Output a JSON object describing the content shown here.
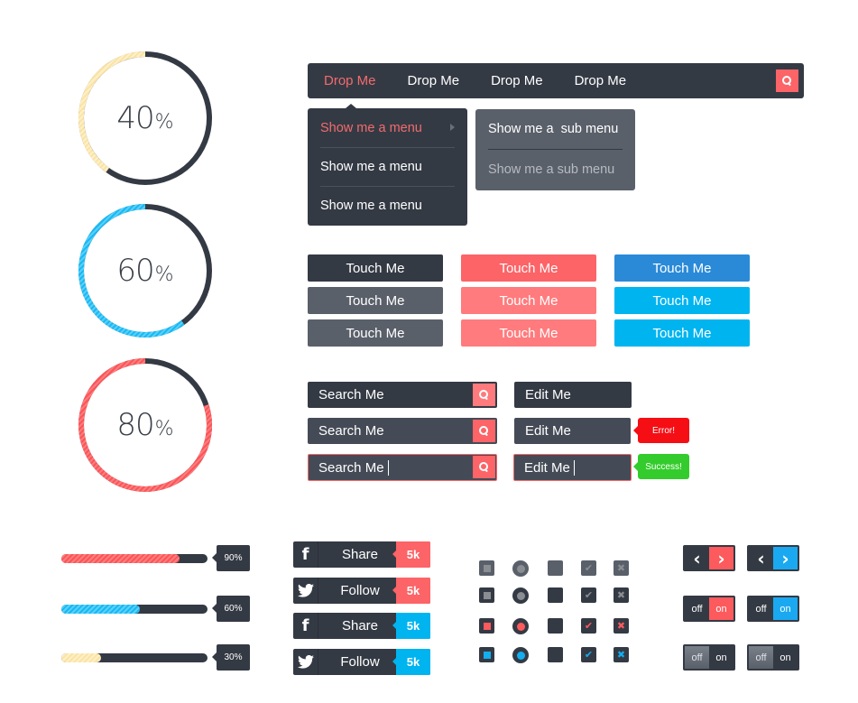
{
  "colors": {
    "dark": "#343a44",
    "gray": "#5a606a",
    "red": "#fc6467",
    "red_light": "#ff7a7c",
    "blue": "#2a8ad8",
    "cyan": "#00b4f0",
    "yellow": "#fbe3a2",
    "error": "#f50e14",
    "success": "#34cc2c"
  },
  "rings": [
    {
      "value": 40,
      "number_label": "40",
      "percent_sign": "%",
      "color": "yellow"
    },
    {
      "value": 60,
      "number_label": "60",
      "percent_sign": "%",
      "color": "cyan"
    },
    {
      "value": 80,
      "number_label": "80",
      "percent_sign": "%",
      "color": "red"
    }
  ],
  "navbar": {
    "items": [
      {
        "label": "Drop Me",
        "active": true
      },
      {
        "label": "Drop Me",
        "active": false
      },
      {
        "label": "Drop Me",
        "active": false
      },
      {
        "label": "Drop Me",
        "active": false
      }
    ],
    "search_icon": "search-icon"
  },
  "dropdown": {
    "items": [
      {
        "label": "Show me a menu",
        "active": true,
        "has_submenu": true
      },
      {
        "label": "Show me a menu",
        "active": false
      },
      {
        "label": "Show me a menu",
        "active": false
      }
    ]
  },
  "submenu": {
    "items": [
      {
        "label": "Show me a  sub menu"
      },
      {
        "label": "Show me a sub menu"
      }
    ]
  },
  "buttons": [
    {
      "label": "Touch Me",
      "style": "dark",
      "state": "normal"
    },
    {
      "label": "Touch Me",
      "style": "red",
      "state": "normal"
    },
    {
      "label": "Touch Me",
      "style": "blue",
      "state": "normal"
    },
    {
      "label": "Touch Me",
      "style": "dark",
      "state": "hover"
    },
    {
      "label": "Touch Me",
      "style": "red",
      "state": "hover"
    },
    {
      "label": "Touch Me",
      "style": "blue",
      "state": "hover"
    },
    {
      "label": "Touch Me",
      "style": "dark",
      "state": "active"
    },
    {
      "label": "Touch Me",
      "style": "red",
      "state": "active"
    },
    {
      "label": "Touch Me",
      "style": "blue",
      "state": "active"
    }
  ],
  "search_inputs": [
    {
      "value": "Search Me",
      "state": "normal"
    },
    {
      "value": "Search Me",
      "state": "hover"
    },
    {
      "value": "Search Me",
      "state": "focus"
    }
  ],
  "edit_inputs": [
    {
      "value": "Edit Me",
      "state": "normal"
    },
    {
      "value": "Edit Me",
      "state": "hover",
      "tooltip": "Error!"
    },
    {
      "value": "Edit Me",
      "state": "focus",
      "tooltip": "Success!"
    }
  ],
  "progress_bars": [
    {
      "value": 90,
      "label": "90%",
      "color": "red"
    },
    {
      "value": 60,
      "label": "60%",
      "color": "blue"
    },
    {
      "value": 30,
      "label": "30%",
      "color": "yellow"
    }
  ],
  "social_buttons": [
    {
      "network": "facebook",
      "icon": "f",
      "label": "Share",
      "count": "5k",
      "color": "red"
    },
    {
      "network": "twitter",
      "label": "Follow",
      "count": "5k",
      "color": "red"
    },
    {
      "network": "facebook",
      "icon": "f",
      "label": "Share",
      "count": "5k",
      "color": "cyan"
    },
    {
      "network": "twitter",
      "label": "Follow",
      "count": "5k",
      "color": "cyan"
    }
  ],
  "form_controls": {
    "check_glyph": "✔",
    "cross_glyph": "✖",
    "rows": [
      {
        "state": "disabled",
        "accent": "#8a8d92"
      },
      {
        "state": "unchecked",
        "accent": "#8a8d92"
      },
      {
        "state": "checked-red",
        "accent": "#fc5a5d"
      },
      {
        "state": "checked-blue",
        "accent": "#13aef0"
      }
    ]
  },
  "pagers": [
    {
      "prev": "‹",
      "next": "›",
      "accent": "red"
    },
    {
      "prev": "‹",
      "next": "›",
      "accent": "cyan"
    }
  ],
  "toggles": [
    {
      "off_label": "off",
      "on_label": "on",
      "state": "on",
      "accent": "red"
    },
    {
      "off_label": "off",
      "on_label": "on",
      "state": "on",
      "accent": "cyan"
    },
    {
      "off_label": "off",
      "on_label": "on",
      "state": "off"
    },
    {
      "off_label": "off",
      "on_label": "on",
      "state": "off"
    }
  ]
}
